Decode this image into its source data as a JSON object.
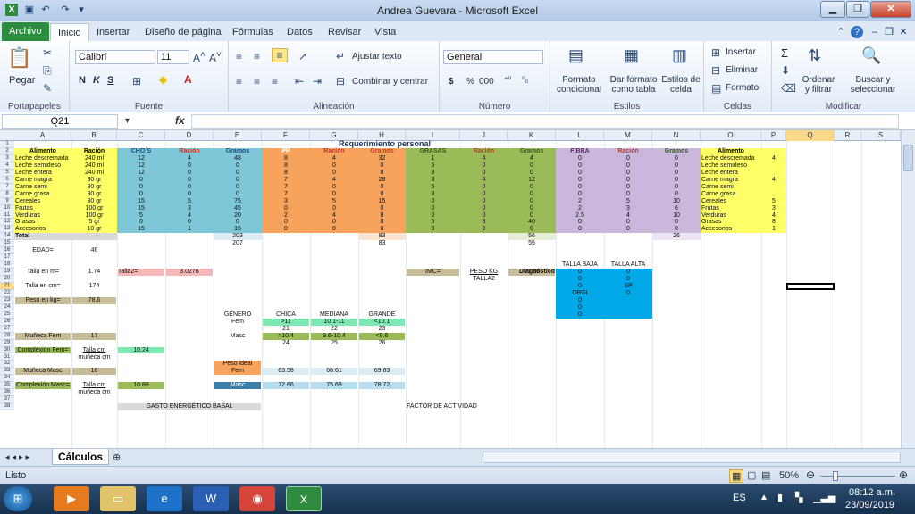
{
  "window": {
    "title": "Andrea Guevara  -  Microsoft Excel"
  },
  "ribbon_tabs": [
    "Archivo",
    "Inicio",
    "Insertar",
    "Diseño de página",
    "Fórmulas",
    "Datos",
    "Revisar",
    "Vista"
  ],
  "clipboard": {
    "paste": "Pegar",
    "group": "Portapapeles"
  },
  "font": {
    "name": "Calibri",
    "size": "11",
    "bold": "N",
    "italic": "K",
    "underline": "S",
    "group": "Fuente"
  },
  "alignment": {
    "wrap": "Ajustar texto",
    "merge": "Combinar y centrar",
    "group": "Alineación"
  },
  "number": {
    "format": "General",
    "currency": "$",
    "percent": "%",
    "thousands": "000",
    "group": "Número"
  },
  "styles": {
    "cond": "Formato condicional",
    "table": "Dar formato como tabla",
    "cell": "Estilos de celda",
    "group": "Estilos"
  },
  "cells": {
    "insert": "Insertar",
    "delete": "Eliminar",
    "format": "Formato",
    "group": "Celdas"
  },
  "editing": {
    "sum": "Σ",
    "sort": "Ordenar y filtrar",
    "find": "Buscar y seleccionar",
    "group": "Modificar"
  },
  "formula_bar": {
    "name_box": "Q21",
    "fx": "fx",
    "value": ""
  },
  "col_headers": [
    "A",
    "B",
    "C",
    "D",
    "E",
    "F",
    "G",
    "H",
    "I",
    "J",
    "K",
    "L",
    "M",
    "N",
    "O",
    "P",
    "Q",
    "R",
    "S"
  ],
  "row_headers": [
    "1",
    "2",
    "3",
    "4",
    "5",
    "6",
    "7",
    "8",
    "9",
    "10",
    "11",
    "12",
    "13",
    "14",
    "15",
    "16",
    "17",
    "18",
    "19",
    "20",
    "21",
    "22",
    "23",
    "24",
    "25",
    "26",
    "27",
    "28",
    "29",
    "30",
    "31",
    "32",
    "33",
    "34",
    "35",
    "36",
    "37",
    "38"
  ],
  "sheet": {
    "title": "Requerimiento personal",
    "hdr": [
      "Alimento",
      "Ración",
      "CHO´S",
      "Ración",
      "Gramos",
      "PP",
      "Ración",
      "Gramos",
      "GRASAS",
      "Ración",
      "Gramos",
      "FIBRA",
      "Ración",
      "Gramos",
      "Alimento"
    ],
    "rows": [
      [
        "Leche descremada",
        "240 ml",
        "12",
        "4",
        "48",
        "8",
        "4",
        "32",
        "1",
        "4",
        "4",
        "0",
        "0",
        "0",
        "Leche descremada",
        "4"
      ],
      [
        "Leche semideso",
        "240 ml",
        "12",
        "0",
        "0",
        "8",
        "0",
        "0",
        "5",
        "0",
        "0",
        "0",
        "0",
        "0",
        "Leche semideso",
        ""
      ],
      [
        "Leche entera",
        "240 ml",
        "12",
        "0",
        "0",
        "8",
        "0",
        "0",
        "8",
        "0",
        "0",
        "0",
        "0",
        "0",
        "Leche entera",
        ""
      ],
      [
        "Carne magra",
        "30 gr",
        "0",
        "0",
        "0",
        "7",
        "4",
        "28",
        "3",
        "4",
        "12",
        "0",
        "0",
        "0",
        "Carne magra",
        "4"
      ],
      [
        "Carne semi",
        "30 gr",
        "0",
        "0",
        "0",
        "7",
        "0",
        "0",
        "5",
        "0",
        "0",
        "0",
        "0",
        "0",
        "Carne semi",
        ""
      ],
      [
        "Carne grasa",
        "30 gr",
        "0",
        "0",
        "0",
        "7",
        "0",
        "0",
        "8",
        "0",
        "0",
        "0",
        "0",
        "0",
        "Carne grasa",
        ""
      ],
      [
        "Cereales",
        "30 gr",
        "15",
        "5",
        "75",
        "3",
        "5",
        "15",
        "0",
        "0",
        "0",
        "2",
        "5",
        "10",
        "Cereales",
        "5"
      ],
      [
        "Frutas",
        "100 gr",
        "15",
        "3",
        "45",
        "0",
        "0",
        "0",
        "0",
        "0",
        "0",
        "2",
        "3",
        "6",
        "Frutas",
        "3"
      ],
      [
        "Verduras",
        "100 gr",
        "5",
        "4",
        "20",
        "2",
        "4",
        "8",
        "0",
        "0",
        "0",
        "2.5",
        "4",
        "10",
        "Verduras",
        "4"
      ],
      [
        "Grasas",
        "5 gr",
        "0",
        "0",
        "0",
        "0",
        "0",
        "0",
        "5",
        "8",
        "40",
        "0",
        "0",
        "0",
        "Grasas",
        "8"
      ],
      [
        "Accesorios",
        "10 gr",
        "15",
        "1",
        "15",
        "0",
        "0",
        "0",
        "0",
        "0",
        "0",
        "0",
        "0",
        "0",
        "Accesorios",
        "1"
      ]
    ],
    "total_label": "Total",
    "total_gramos_cho": "203",
    "total_gramos_pp": "83",
    "total_gramos_grasas": "56",
    "total_gramos_fibra": "26",
    "r15_e": "207",
    "r15_h": "83",
    "r15_k": "55",
    "edad_label": "EDAD=",
    "edad": "46",
    "talla_m_label": "Talla en m=",
    "talla_m": "1.74",
    "talla2_label": "Talla2=",
    "talla2": "3.0276",
    "imc_label": "IMC=",
    "peso_kg_label": "PESO KG",
    "talla2_b": "TALLA2",
    "imc": "25.96",
    "diag_label": "Diagnóstico",
    "talla_baja": "TALLA BAJA",
    "talla_alta": "TALLA ALTA",
    "diag_rows": [
      [
        "0",
        "0"
      ],
      [
        "0",
        "0"
      ],
      [
        "0",
        "SP"
      ],
      [
        "OBGI",
        "0"
      ],
      [
        "0",
        ""
      ],
      [
        "0",
        ""
      ],
      [
        "0",
        ""
      ]
    ],
    "talla_cm_label": "Talla en cm=",
    "talla_cm": "174",
    "peso_label": "Peso en kg=",
    "peso": "78.6",
    "genero": "GÉNERO",
    "chica": "CHICA",
    "mediana": "MEDIANA",
    "grande": "GRANDE",
    "fem": "Fem",
    "fem_vals": [
      ">11",
      "10.1-11",
      "<10.1"
    ],
    "fem_nums": [
      "21",
      "22",
      "23"
    ],
    "masc": "Masc",
    "masc_vals": [
      ">10.4",
      "9.6-10.4",
      "<9.6"
    ],
    "masc_nums": [
      "24",
      "25",
      "26"
    ],
    "muneca_fem_label": "Muñeca  Fem",
    "muneca_fem": "17",
    "complexion_fem_label": "Complexión Fem=",
    "talla_cm_u": "Talla cm",
    "muneca_cm": "muñeca cm",
    "complexion_fem": "10.24",
    "peso_ideal": "Peso ideal",
    "pi_fem": "Fem",
    "pi_fem_vals": [
      "63.58",
      "66.61",
      "69.63"
    ],
    "muneca_masc_label": "Muñeca Masc",
    "muneca_masc": "16",
    "complexion_masc_label": "Complexión Masc=",
    "complexion_masc": "10.88",
    "pi_masc": "Masc",
    "pi_masc_vals": [
      "72.66",
      "75.69",
      "78.72"
    ],
    "geb": "GASTO ENERGÉTICO BASAL",
    "factor": "FACTOR DE ACTIVIDAD"
  },
  "sheet_tab": "Cálculos",
  "status": {
    "ready": "Listo",
    "zoom": "50%"
  },
  "taskbar": {
    "lang": "ES",
    "time": "08:12 a.m.",
    "date": "23/09/2019"
  },
  "colors": {
    "yellow": "#ffff66",
    "blue": "#7dc7d8",
    "orange": "#f7a35c",
    "green": "#9bbb59",
    "purple": "#c9b8dc",
    "cyan": "#00a8e8"
  }
}
